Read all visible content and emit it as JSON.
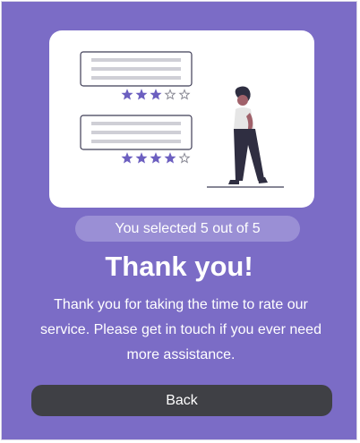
{
  "rating": {
    "selected": 5,
    "max": 5,
    "selection_text": "You selected 5 out of 5"
  },
  "thank_you": {
    "title": "Thank you!",
    "message": "Thank you for taking the time to rate our service. Please get in touch if you ever need more assistance."
  },
  "actions": {
    "back_label": "Back"
  },
  "illustration": {
    "review_cards": [
      {
        "filled_stars": 3,
        "total_stars": 5
      },
      {
        "filled_stars": 4,
        "total_stars": 5
      }
    ]
  },
  "colors": {
    "background": "#7b6cc6",
    "star": "#6c5fc0",
    "pill": "#9a8fd5",
    "button": "#3f4045"
  }
}
